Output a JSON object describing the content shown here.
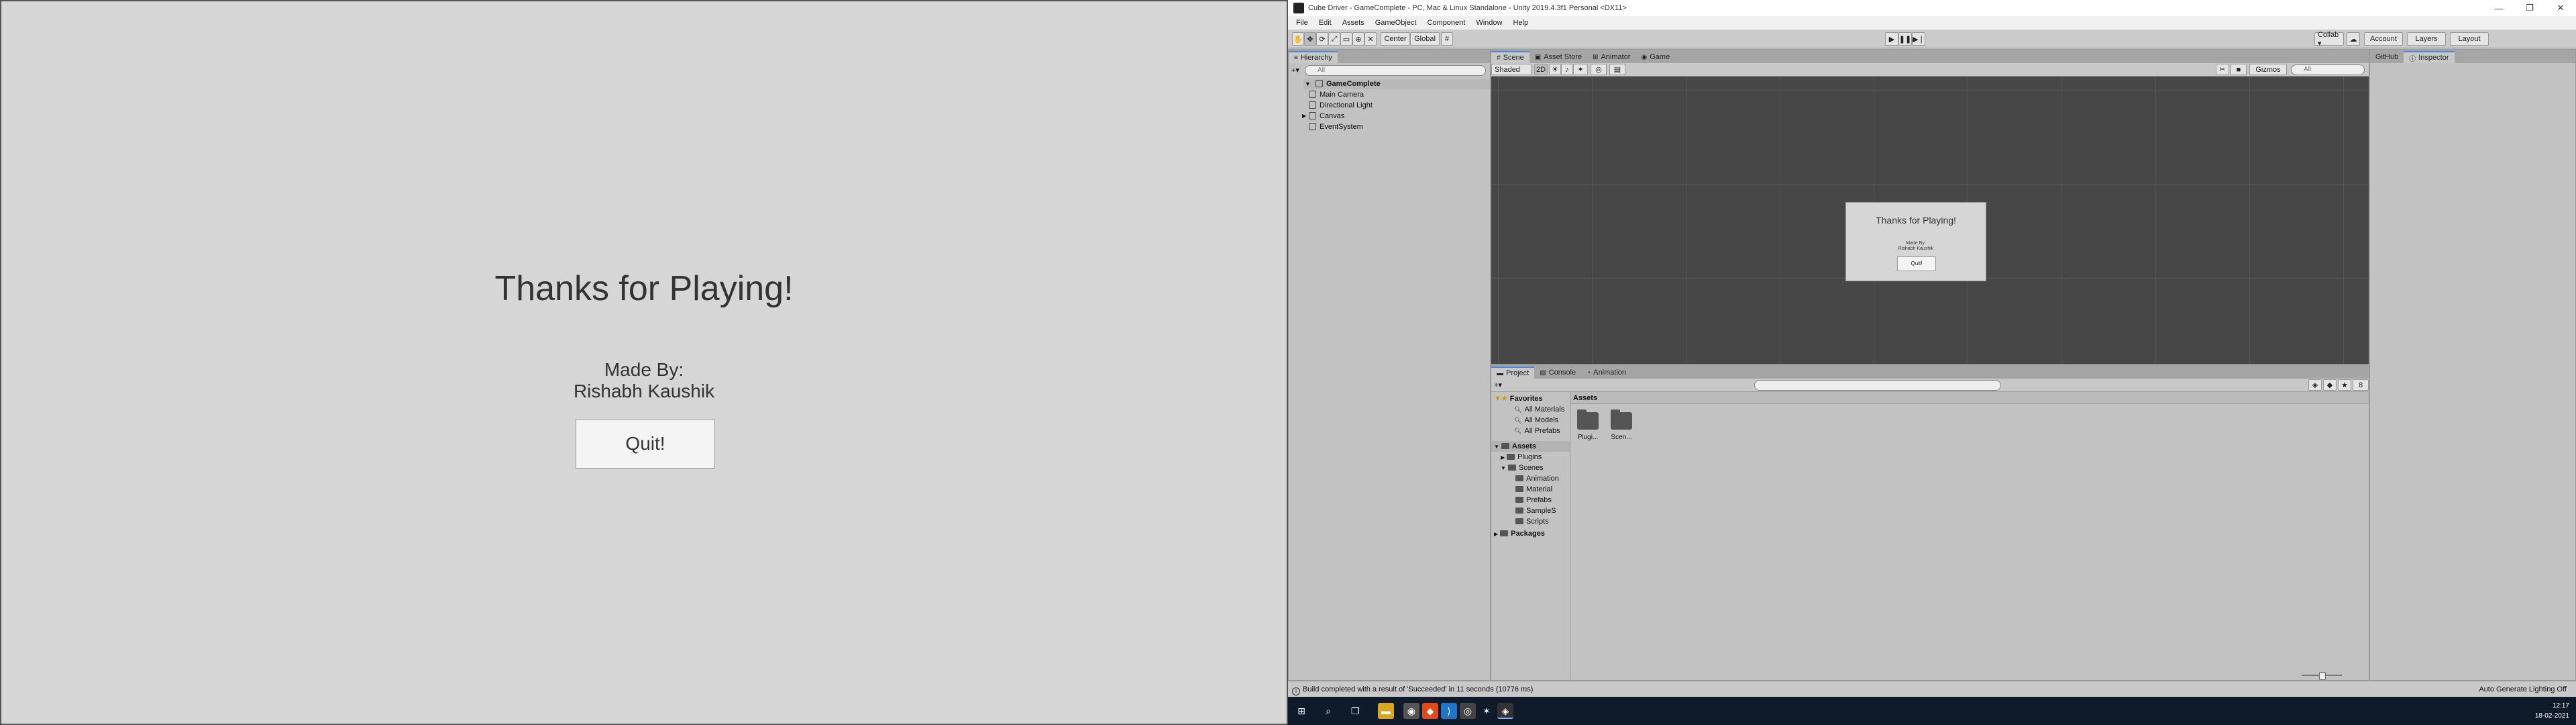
{
  "game": {
    "title": "Thanks for Playing!",
    "made_by_line1": "Made By:",
    "made_by_line2": "Rishabh Kaushik",
    "quit_label": "Quit!"
  },
  "window": {
    "title": "Cube Driver - GameComplete - PC, Mac & Linux Standalone - Unity 2019.4.3f1 Personal <DX11>",
    "minimize": "—",
    "maximize": "❐",
    "close": "✕"
  },
  "menu": [
    "File",
    "Edit",
    "Assets",
    "GameObject",
    "Component",
    "Window",
    "Help"
  ],
  "toolbar": {
    "center_label": "Center",
    "global_label": "Global",
    "collab_label": "Collab ▾",
    "account_label": "Account",
    "layers_label": "Layers",
    "layout_label": "Layout"
  },
  "hierarchy": {
    "tab_label": "Hierarchy",
    "search_placeholder": "All",
    "root": "GameComplete",
    "items": [
      "Main Camera",
      "Directional Light",
      "Canvas",
      "EventSystem"
    ]
  },
  "scene": {
    "tabs": [
      "Scene",
      "Asset Store",
      "Animator",
      "Game"
    ],
    "shading": "Shaded",
    "mode_2d": "2D",
    "gizmos": "Gizmos",
    "search_placeholder": "All",
    "preview": {
      "title": "Thanks for Playing!",
      "made_by_line1": "Made By:",
      "made_by_line2": "Rishabh Kaushik",
      "quit_label": "Quit!"
    }
  },
  "project": {
    "tabs": [
      "Project",
      "Console",
      "Animation"
    ],
    "favorites_label": "Favorites",
    "favorites": [
      "All Materials",
      "All Models",
      "All Prefabs"
    ],
    "assets_label": "Assets",
    "asset_tree": [
      "Plugins",
      "Scenes",
      "Animation",
      "Material",
      "Prefabs",
      "SampleS",
      "Scripts"
    ],
    "packages_label": "Packages",
    "main_header": "Assets",
    "assets": [
      "Plugi...",
      "Scen..."
    ],
    "hidden_count": "8"
  },
  "inspector": {
    "tabs": [
      "GitHub",
      "Inspector"
    ]
  },
  "status": {
    "message": "Build completed with a result of 'Succeeded' in 11 seconds (10776 ms)",
    "right": "Auto Generate Lighting Off"
  },
  "taskbar": {
    "time": "12:17",
    "date": "18-02-2021"
  }
}
